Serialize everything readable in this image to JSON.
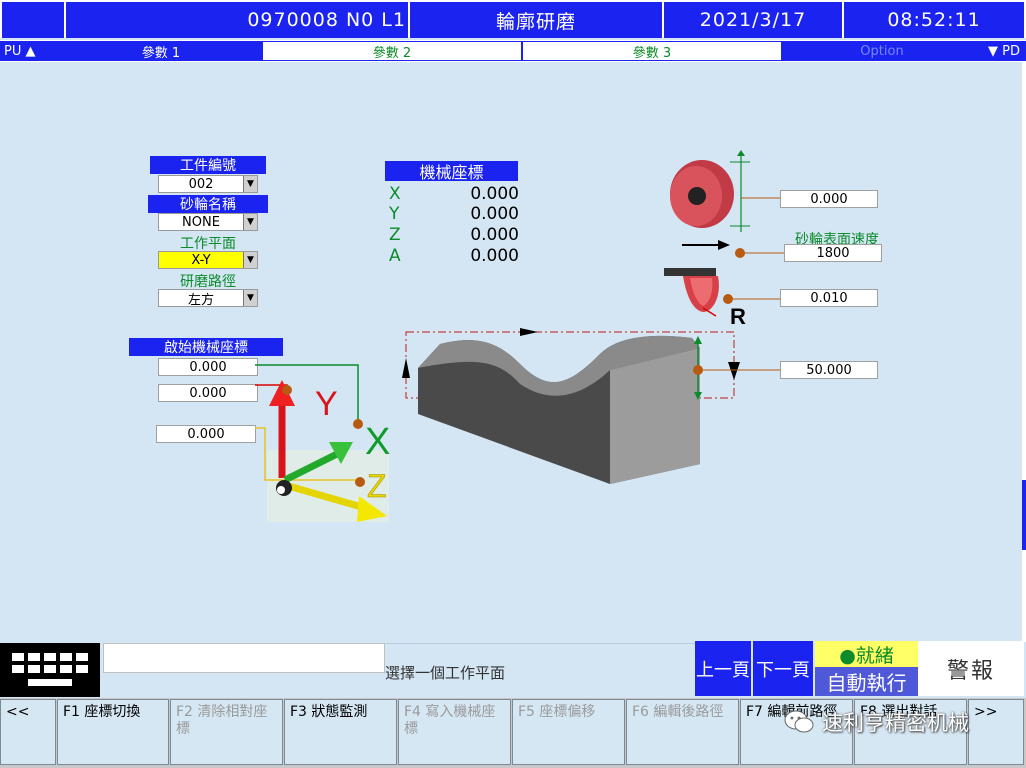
{
  "header": {
    "program": "0970008 N0 L1",
    "title": "輪廓研磨",
    "date": "2021/3/17",
    "time": "08:52:11"
  },
  "tabs": {
    "left": "PU ▲",
    "tab1": "參數 1",
    "tab2": "參數 2",
    "tab3": "參數 3",
    "tab4": "Option",
    "right": "▼ PD"
  },
  "left_panel": {
    "workpiece_no_label": "工件編號",
    "workpiece_no": "002",
    "wheel_name_label": "砂輪名稱",
    "wheel_name": "NONE",
    "work_plane_label": "工作平面",
    "work_plane": "X-Y",
    "grind_path_label": "研磨路徑",
    "grind_path": "左方",
    "start_coord_label": "啟始機械座標",
    "start_x": "0.000",
    "start_y": "0.000",
    "start_z": "0.000"
  },
  "machine_coords": {
    "label": "機械座標",
    "axes": [
      {
        "axis": "X",
        "value": "0.000"
      },
      {
        "axis": "Y",
        "value": "0.000"
      },
      {
        "axis": "Z",
        "value": "0.000"
      },
      {
        "axis": "A",
        "value": "0.000"
      }
    ]
  },
  "diagram": {
    "axis_x": "X",
    "axis_y": "Y",
    "axis_z": "Z",
    "radius_letter": "R",
    "wheel_offset": "0.000",
    "surface_speed_label": "砂輪表面速度",
    "surface_speed": "1800",
    "radius_value": "0.010",
    "depth_value": "50.000"
  },
  "bottom": {
    "message": "選擇一個工作平面",
    "prev_page": "上一頁",
    "next_page": "下一頁",
    "status_ready": "●就緒",
    "status_auto": "自動執行",
    "alarm": "警報"
  },
  "fkeys": [
    {
      "label": "<<"
    },
    {
      "label": "F1 座標切換"
    },
    {
      "label": "F2 清除相對座標"
    },
    {
      "label": "F3 狀態監測"
    },
    {
      "label": "F4 寫入機械座標"
    },
    {
      "label": "F5 座標偏移"
    },
    {
      "label": "F6 編輯後路徑"
    },
    {
      "label": "F7 編輯前路徑"
    },
    {
      "label": "F8 選出對話"
    },
    {
      "label": ">>"
    }
  ],
  "watermark": "速利亨精密机械",
  "colors": {
    "title_blue": "#1a23f0",
    "background": "#d4e6f4",
    "label_green": "#0b8b29",
    "highlight_yellow": "#ffff00"
  }
}
